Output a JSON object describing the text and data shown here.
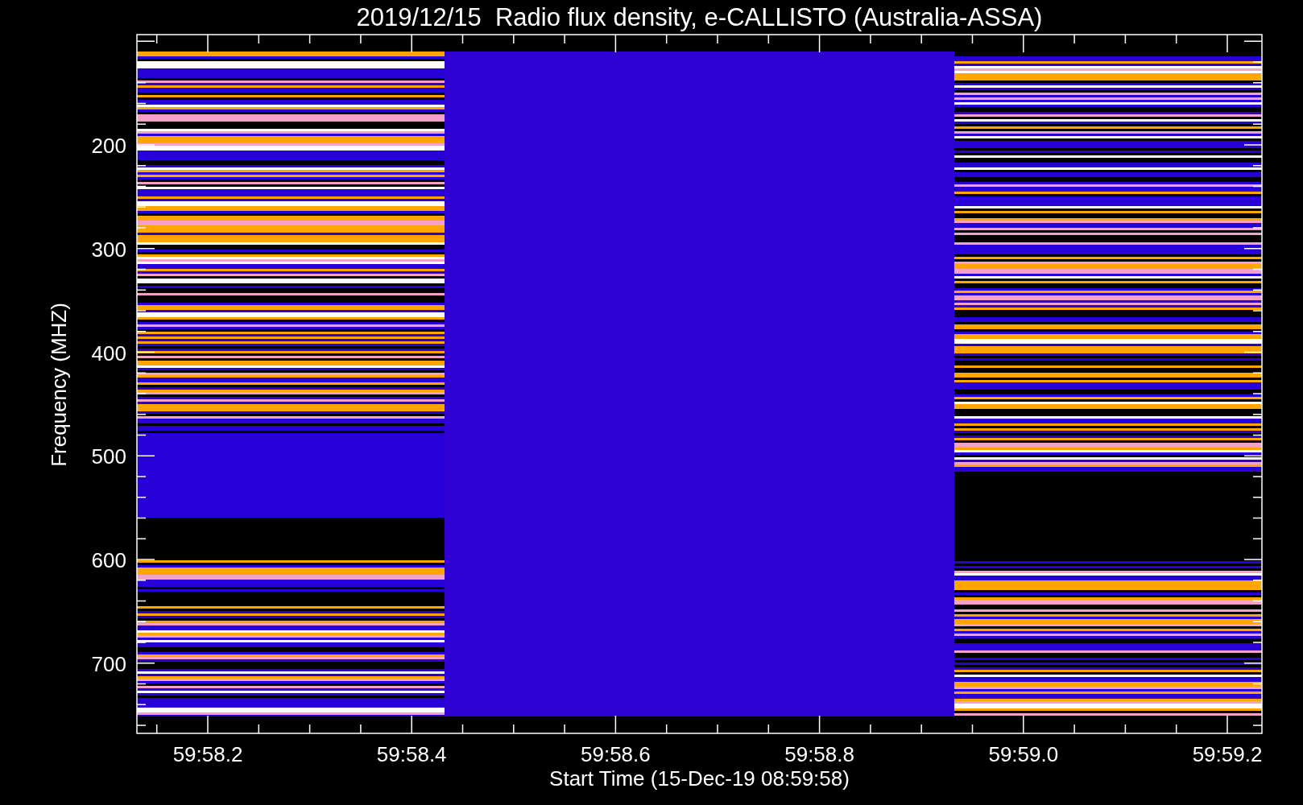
{
  "title": "2019/12/15  Radio flux density, e-CALLISTO (Australia-ASSA)",
  "plot": {
    "ylabel": "Frequency (MHZ)",
    "xlabel": "Start Time (15-Dec-19 08:59:58)",
    "yticks": [
      "200",
      "300",
      "400",
      "500",
      "600",
      "700"
    ],
    "xticks": [
      "59:58.2",
      "59:58.4",
      "59:58.6",
      "59:58.8",
      "59:59.0",
      "59:59.2"
    ]
  }
}
